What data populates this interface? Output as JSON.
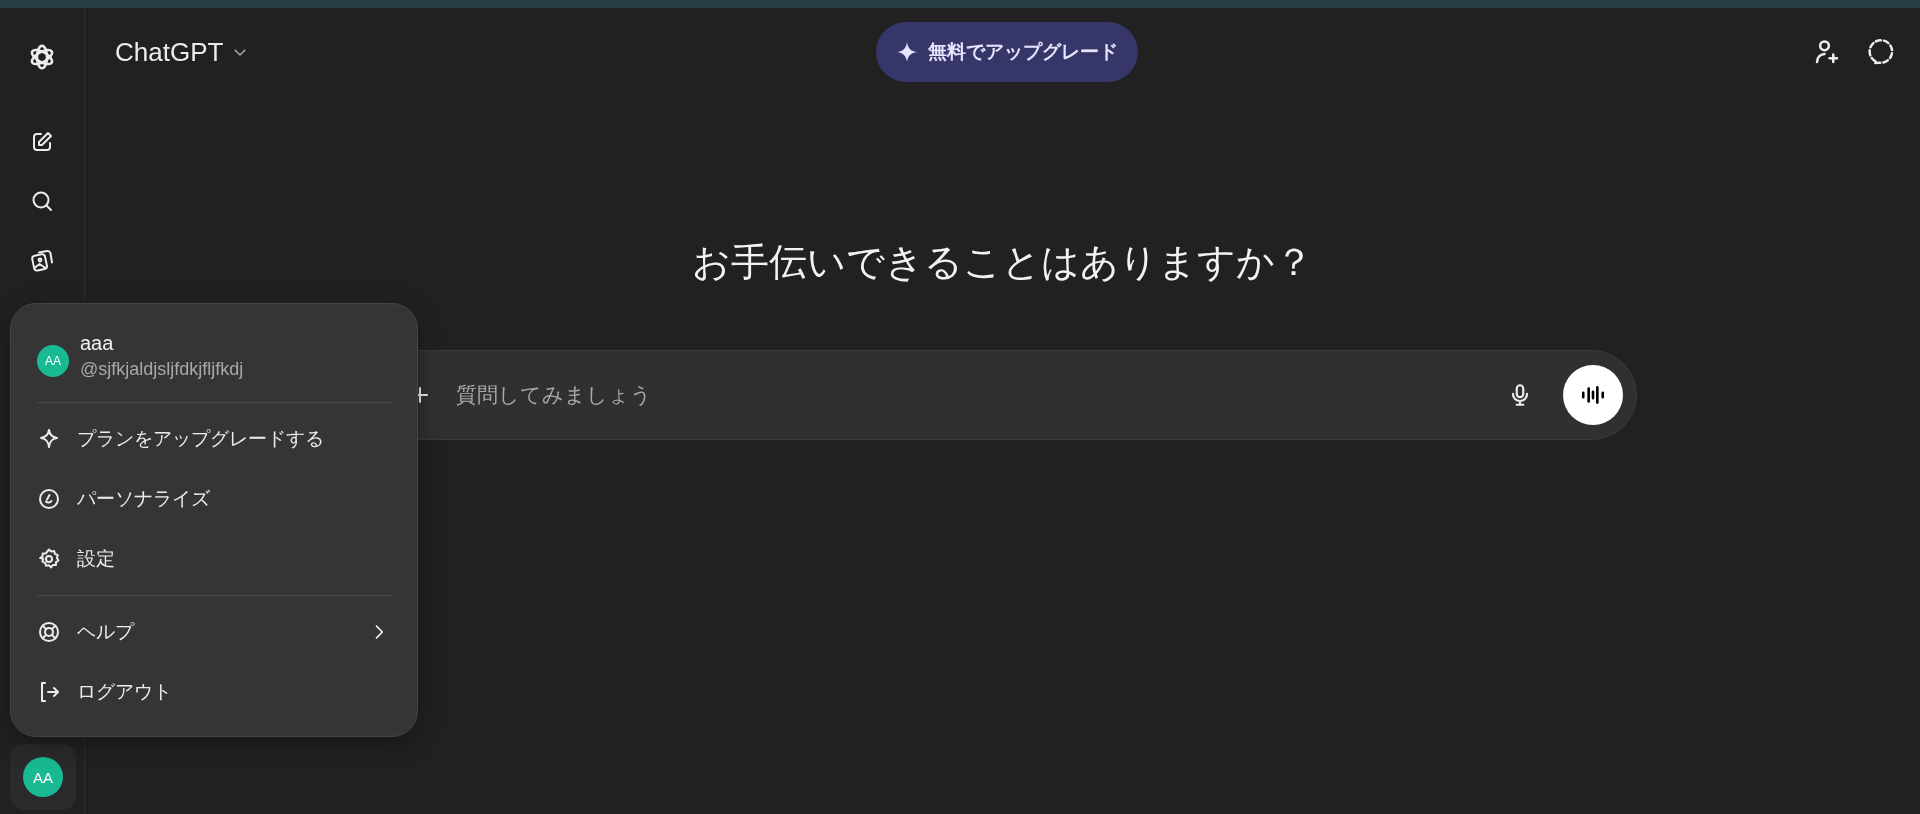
{
  "sidebar": {
    "avatar_initials": "AA"
  },
  "header": {
    "title": "ChatGPT",
    "upgrade_button": "無料でアップグレード"
  },
  "heading": "お手伝いできることはありますか？",
  "composer": {
    "placeholder": "質問してみましょう"
  },
  "account_menu": {
    "avatar_initials": "AA",
    "name": "aaa",
    "handle": "@sjfkjaldjsljfdkjfljfkdj",
    "sections": [
      {
        "items": [
          {
            "label": "プランをアップグレードする",
            "submenu": false
          },
          {
            "label": "パーソナライズ",
            "submenu": false
          },
          {
            "label": "設定",
            "submenu": false
          }
        ]
      },
      {
        "items": [
          {
            "label": "ヘルプ",
            "submenu": true
          },
          {
            "label": "ログアウト",
            "submenu": false
          }
        ]
      }
    ]
  }
}
